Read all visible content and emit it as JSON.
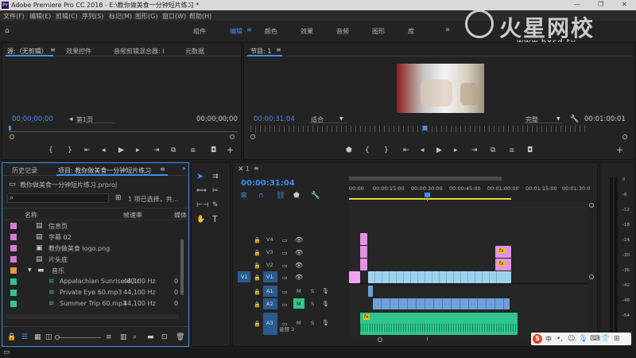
{
  "titlebar": {
    "title": "Adobe Premiere Pro CC 2018 - E:\\教你做美食一分钟短片练习 *",
    "min": "—",
    "max": "❐",
    "close": "✕"
  },
  "menu": [
    "文件(F)",
    "编辑(E)",
    "剪辑(C)",
    "序列(S)",
    "标记(M)",
    "图形(G)",
    "窗口(W)",
    "帮助(H)"
  ],
  "workspaces": {
    "items": [
      "组件",
      "编辑",
      "颜色",
      "效果",
      "音频",
      "图形",
      "库"
    ],
    "active": "编辑",
    "more": "»"
  },
  "watermark": {
    "brand": "火星网校",
    "url": "www.hxsd.tv"
  },
  "source": {
    "tabs": [
      "源:（无剪辑）",
      "效果控件",
      "音频剪辑混合器: I",
      "元数据"
    ],
    "timecode_left": "00;00;00;00",
    "page": "第1页",
    "timecode_right": "00;00;00;00"
  },
  "program": {
    "tab": "节目: 1",
    "timecode": "00:00:31:04",
    "fit": "适合",
    "quality": "完整",
    "duration": "00:01:00:01"
  },
  "project": {
    "tabs": [
      "历史记录",
      "项目: 教你做美食一分钟短片练习"
    ],
    "file": "教你做美食一分钟短片练习.prproj",
    "selection": "1 项已选择，共...",
    "col_name": "名称",
    "col_rate": "帧速率",
    "col_more": "媒体",
    "rows": [
      {
        "name": "信息页",
        "rate": "",
        "color": "#d977d7"
      },
      {
        "name": "字幕 02",
        "rate": "",
        "color": "#d977d7"
      },
      {
        "name": "教你做美食 logo.png",
        "rate": "",
        "color": "#d977d7"
      },
      {
        "name": "片头底",
        "rate": "",
        "color": "#d977d7"
      },
      {
        "name": "音乐",
        "rate": "",
        "color": "#e8963a"
      },
      {
        "name": "Appalachian Sunrise 60.r",
        "rate": "44,100 Hz",
        "color": "#2fc58c"
      },
      {
        "name": "Private Eye 60.mp3",
        "rate": "44,100 Hz",
        "color": "#2fc58c"
      },
      {
        "name": "Summer Trip 60.mp3",
        "rate": "44,100 Hz",
        "color": "#2fc58c"
      }
    ],
    "zero": "0"
  },
  "timeline": {
    "tab": "1",
    "timecode": "00:00:31:04",
    "ruler": [
      "00:00",
      "00:00:15:00",
      "00:00:30:00",
      "00:00:45:00",
      "00:01:00:00",
      "00:01:15:00",
      "00:01:30:0"
    ],
    "tracks_video": [
      "V4",
      "V3",
      "V2",
      "V1"
    ],
    "tracks_audio": [
      "A1",
      "A2",
      "A3"
    ],
    "audio_label": "音频 3",
    "fx": "fx"
  },
  "meter": {
    "labels": [
      "0",
      "-6",
      "-12",
      "-18",
      "-24",
      "-30",
      "-36",
      "-42",
      "-48",
      "-54"
    ],
    "s": "S"
  },
  "taskbar": {
    "ime": "中"
  }
}
